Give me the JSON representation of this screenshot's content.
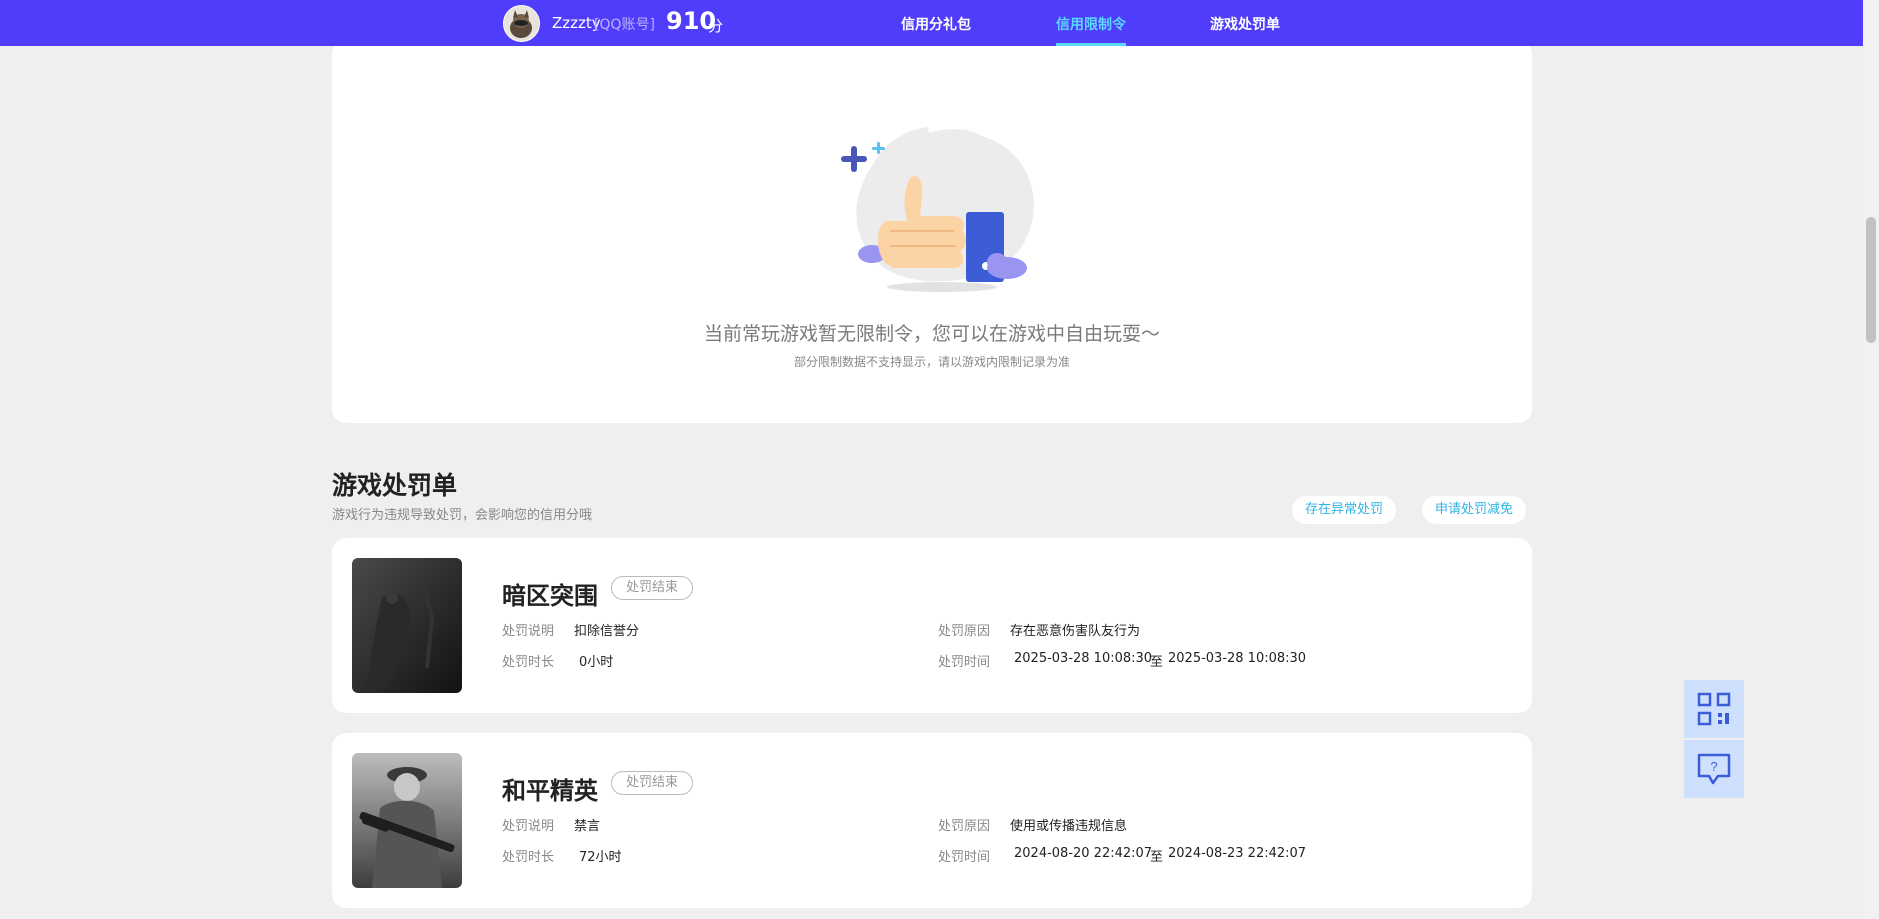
{
  "header": {
    "username": "Zzzzty",
    "account_type": "[QQ账号]",
    "score": "910",
    "score_unit": "分",
    "nav": [
      {
        "label": "信用分礼包",
        "active": false
      },
      {
        "label": "信用限制令",
        "active": true
      },
      {
        "label": "游戏处罚单",
        "active": false
      }
    ]
  },
  "restriction": {
    "empty_message": "当前常玩游戏暂无限制令，您可以在游戏中自由玩耍～",
    "empty_note": "部分限制数据不支持显示，请以游戏内限制记录为准"
  },
  "penalties": {
    "title": "游戏处罚单",
    "subtitle": "游戏行为违规导致处罚，会影响您的信用分哦",
    "buttons": [
      "存在异常处罚",
      "申请处罚减免"
    ],
    "labels": {
      "desc": "处罚说明",
      "duration": "处罚时长",
      "reason": "处罚原因",
      "time": "处罚时间",
      "to": "至"
    },
    "items": [
      {
        "game": "暗区突围",
        "status": "处罚结束",
        "desc": "扣除信誉分",
        "duration": "0小时",
        "reason": "存在恶意伤害队友行为",
        "start": "2025-03-28 10:08:30",
        "end": "2025-03-28 10:08:30"
      },
      {
        "game": "和平精英",
        "status": "处罚结束",
        "desc": "禁言",
        "duration": "72小时",
        "reason": "使用或传播违规信息",
        "start": "2024-08-20 22:42:07",
        "end": "2024-08-23 22:42:07"
      }
    ]
  },
  "floating": {
    "icons": [
      "qr-code-icon",
      "help-chat-icon"
    ]
  },
  "colors": {
    "header_bg": "#4f3dfb",
    "active_nav": "#5ad8ff",
    "accent_link": "#2fb3e6",
    "page_bg": "#efefef"
  }
}
